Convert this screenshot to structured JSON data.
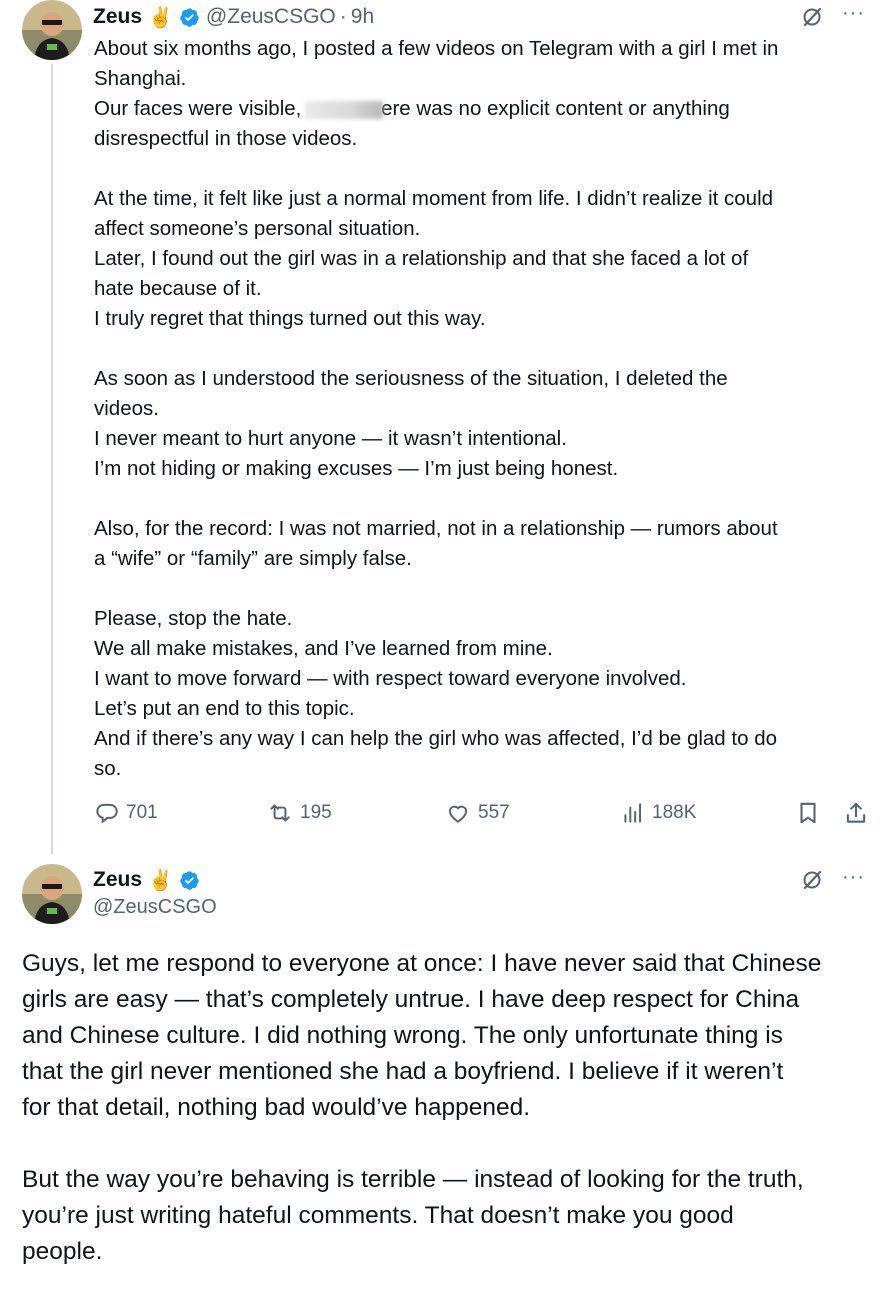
{
  "tweet1": {
    "display_name": "Zeus",
    "emoji": "✌",
    "handle": "@ZeusCSGO",
    "separator": "·",
    "time": "9h",
    "more": "···",
    "paragraphs": [
      [
        "About six months ago, I posted a few videos on Telegram with a girl I met in",
        "Shanghai.",
        "Our faces were visible, [redacted] ere was no explicit content or anything",
        "disrespectful in those videos."
      ],
      [
        "At the time, it felt like just a normal moment from life. I didn’t realize it could",
        "affect someone’s personal situation.",
        "Later, I found out the girl was in a relationship and that she faced a lot of",
        "hate because of it.",
        "I truly regret that things turned out this way."
      ],
      [
        "As soon as I understood the seriousness of the situation, I deleted the",
        "videos.",
        "I never meant to hurt anyone — it wasn’t intentional.",
        "I’m not hiding or making excuses — I’m just being honest."
      ],
      [
        "Also, for the record: I was not married, not in a relationship — rumors about",
        "a “wife” or “family” are simply false."
      ],
      [
        "Please, stop the hate.",
        "We all make mistakes, and I’ve learned from mine.",
        "I want to move forward — with respect toward everyone involved.",
        "Let’s put an end to this topic.",
        "And if there’s any way I can help the girl who was affected, I’d be glad to do",
        "so."
      ]
    ],
    "line3_before": "Our faces were visible,",
    "line3_after": "ere was no explicit content or anything",
    "replies": "701",
    "reposts": "195",
    "likes": "557",
    "views": "188K"
  },
  "tweet2": {
    "display_name": "Zeus",
    "emoji": "✌",
    "handle": "@ZeusCSGO",
    "more": "···",
    "p1": [
      "Guys, let me respond to everyone at once: I have never said that Chinese",
      "girls are easy — that’s completely untrue. I have deep respect for China",
      "and Chinese culture. I did nothing wrong. The only unfortunate thing is",
      "that the girl never mentioned she had a boyfriend. I believe if it weren’t",
      "for that detail, nothing bad would’ve happened."
    ],
    "p2": [
      "But the way you’re behaving is terrible — instead of looking for the truth,",
      "you’re just writing hateful comments. That doesn’t make you good",
      "people."
    ]
  },
  "colors": {
    "verified": "#1d9bf0",
    "muted": "#536471",
    "text": "#0f1419",
    "thread": "#cfd9de"
  },
  "icons": [
    "verified-badge-icon",
    "grok-icon",
    "more-icon",
    "reply-icon",
    "repost-icon",
    "like-icon",
    "views-icon",
    "bookmark-icon",
    "share-icon"
  ]
}
